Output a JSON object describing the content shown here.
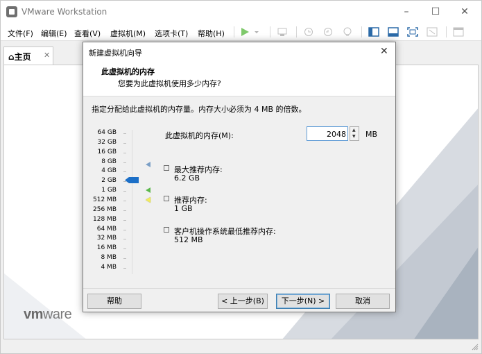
{
  "app": {
    "title": "VMware Workstation",
    "window_controls": {
      "minimize": "–",
      "maximize": "☐",
      "close": "✕"
    }
  },
  "menubar": [
    "文件(F)",
    "编辑(E)",
    "查看(V)",
    "虚拟机(M)",
    "选项卡(T)",
    "帮助(H)"
  ],
  "toolbar": {
    "icons": [
      "play-icon",
      "dropdown-icon",
      "send-ctrl-alt-del-icon",
      "snapshot-icon",
      "revert-snapshot-icon",
      "manage-snapshots-icon",
      "console-view-icon",
      "unity-view-icon",
      "fullscreen-icon",
      "stretch-icon",
      "library-icon"
    ]
  },
  "tabs": {
    "home_icon": "⌂",
    "home_label": "主页",
    "home_close": "✕"
  },
  "brand": {
    "logo_vm": "vm",
    "logo_ware": "ware"
  },
  "dialog": {
    "title": "新建虚拟机向导",
    "close": "✕",
    "heading": "此虚拟机的内存",
    "subheading": "您要为此虚拟机使用多少内存?",
    "instruction": "指定分配给此虚拟机的内存量。内存大小必须为 4 MB 的倍数。",
    "memory_label": "此虚拟机的内存(M):",
    "memory_value": "2048",
    "memory_unit": "MB",
    "spin_up": "▲",
    "spin_down": "▼",
    "scale_labels": [
      "64 GB",
      "32 GB",
      "16 GB",
      "8 GB",
      "4 GB",
      "2 GB",
      "1 GB",
      "512 MB",
      "256 MB",
      "128 MB",
      "64 MB",
      "32 MB",
      "16 MB",
      "8 MB",
      "4 MB"
    ],
    "legend": [
      {
        "title": "最大推荐内存:",
        "value": "6.2 GB",
        "color": "#7b9fc6"
      },
      {
        "title": "推荐内存:",
        "value": "1 GB",
        "color": "#5bb84b"
      },
      {
        "title": "客户机操作系统最低推荐内存:",
        "value": "512 MB",
        "color": "#f2ec5c"
      }
    ],
    "buttons": {
      "help": "帮助",
      "back": "< 上一步(B)",
      "next": "下一步(N) >",
      "cancel": "取消"
    }
  },
  "colors": {
    "accent": "#1c6fc7",
    "max_marker": "#7b9fc6",
    "recommended_marker": "#5bb84b",
    "min_marker": "#f2ec5c"
  }
}
